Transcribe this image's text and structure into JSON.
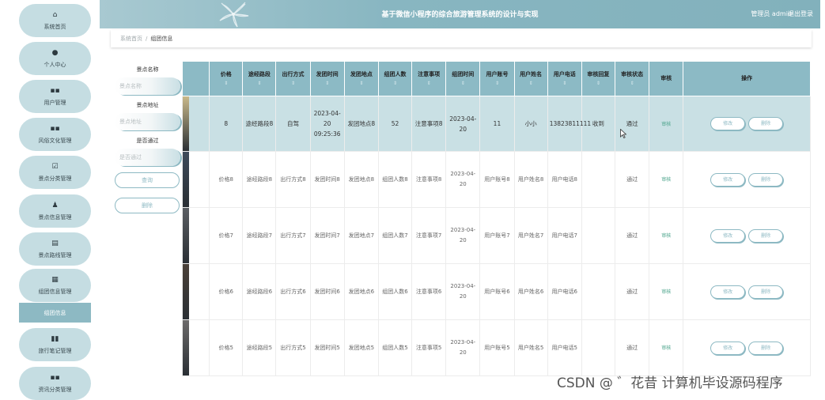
{
  "sidebar": {
    "items": [
      {
        "icon": "home-icon",
        "glyph": "⌂",
        "label": "系统首页"
      },
      {
        "icon": "user-icon",
        "glyph": "●",
        "label": "个人中心"
      },
      {
        "icon": "grid-icon",
        "glyph": "▪▪",
        "label": "用户管理"
      },
      {
        "icon": "grid-icon",
        "glyph": "▪▪",
        "label": "风俗文化管理"
      },
      {
        "icon": "check-square-icon",
        "glyph": "☑",
        "label": "景点分类管理"
      },
      {
        "icon": "person-icon",
        "glyph": "♟",
        "label": "景点信息管理"
      },
      {
        "icon": "printer-icon",
        "glyph": "▤",
        "label": "景点路线管理"
      },
      {
        "icon": "table-icon",
        "glyph": "▦",
        "label": "组团信息管理"
      },
      {
        "icon": "bar-chart-icon",
        "glyph": "▮▮",
        "label": "旅行笔记管理"
      },
      {
        "icon": "grid-icon",
        "glyph": "▪▪",
        "label": "资讯分类管理"
      }
    ],
    "active_sub": "组团信息"
  },
  "header": {
    "title": "基于微信小程序的综合旅游管理系统的设计与实现",
    "user": "管理员 admin",
    "logout": "退出登录"
  },
  "breadcrumb": {
    "home": "系统首页",
    "separator": "/",
    "current": "组团信息"
  },
  "search": {
    "name_label": "景点名称",
    "name_placeholder": "景点名称",
    "address_label": "景点地址",
    "address_placeholder": "景点地址",
    "pass_label": "是否通过",
    "pass_placeholder": "是否通过",
    "query_button": "查询",
    "delete_button": "删除"
  },
  "table": {
    "headers": [
      {
        "label": "",
        "sort": ""
      },
      {
        "label": "价格",
        "sort": "⇕"
      },
      {
        "label": "途经路段",
        "sort": "⇕"
      },
      {
        "label": "出行方式",
        "sort": "⇕"
      },
      {
        "label": "发团时间",
        "sort": "⇕"
      },
      {
        "label": "发团地点",
        "sort": "⇕"
      },
      {
        "label": "组团人数",
        "sort": "⇕"
      },
      {
        "label": "注意事项",
        "sort": "⇕"
      },
      {
        "label": "组团时间",
        "sort": "⇕"
      },
      {
        "label": "用户账号",
        "sort": "⇕"
      },
      {
        "label": "用户姓名",
        "sort": "⇕"
      },
      {
        "label": "用户电话",
        "sort": "⇕"
      },
      {
        "label": "审核回复",
        "sort": "⇕"
      },
      {
        "label": "审核状态",
        "sort": "⇕"
      },
      {
        "label": "审核",
        "sort": ""
      },
      {
        "label": "操作",
        "sort": ""
      }
    ],
    "rows": [
      {
        "price": "8",
        "route": "途经路段8",
        "mode": "自驾",
        "depart_time": "2023-04-20 09:25:36",
        "depart_place": "发团地点8",
        "count": "52",
        "notes": "注意事项8",
        "group_time": "2023-04-20",
        "account": "11",
        "name": "小小",
        "phone": "13823811111",
        "reply": "收到",
        "status": "通过",
        "audit": "审核",
        "edit": "修改",
        "delete": "删除"
      },
      {
        "price": "价格8",
        "route": "途经路段8",
        "mode": "出行方式8",
        "depart_time": "发团时间8",
        "depart_place": "发团地点8",
        "count": "组团人数8",
        "notes": "注意事项8",
        "group_time": "2023-04-20",
        "account": "用户账号8",
        "name": "用户姓名8",
        "phone": "用户电话8",
        "reply": "",
        "status": "通过",
        "audit": "审核",
        "edit": "修改",
        "delete": "删除"
      },
      {
        "price": "价格7",
        "route": "途经路段7",
        "mode": "出行方式7",
        "depart_time": "发团时间7",
        "depart_place": "发团地点7",
        "count": "组团人数7",
        "notes": "注意事项7",
        "group_time": "2023-04-20",
        "account": "用户账号7",
        "name": "用户姓名7",
        "phone": "用户电话7",
        "reply": "",
        "status": "通过",
        "audit": "审核",
        "edit": "修改",
        "delete": "删除"
      },
      {
        "price": "价格6",
        "route": "途经路段6",
        "mode": "出行方式6",
        "depart_time": "发团时间6",
        "depart_place": "发团地点6",
        "count": "组团人数6",
        "notes": "注意事项6",
        "group_time": "2023-04-20",
        "account": "用户账号6",
        "name": "用户姓名6",
        "phone": "用户电话6",
        "reply": "",
        "status": "通过",
        "audit": "审核",
        "edit": "修改",
        "delete": "删除"
      },
      {
        "price": "价格5",
        "route": "途经路段5",
        "mode": "出行方式5",
        "depart_time": "发团时间5",
        "depart_place": "发团地点5",
        "count": "组团人数5",
        "notes": "注意事项5",
        "group_time": "2023-04-20",
        "account": "用户账号5",
        "name": "用户姓名5",
        "phone": "用户电话5",
        "reply": "",
        "status": "通过",
        "audit": "审核",
        "edit": "修改",
        "delete": "删除"
      }
    ]
  },
  "watermark": "CSDN @ ゛花昔 计算机毕设源码程序",
  "colors": {
    "accent": "#8db9c3",
    "header": "#88b6c1",
    "nav_bg": "#c5dde2",
    "highlight_row": "#c9e0e4",
    "audit_link": "#4aa38a"
  }
}
